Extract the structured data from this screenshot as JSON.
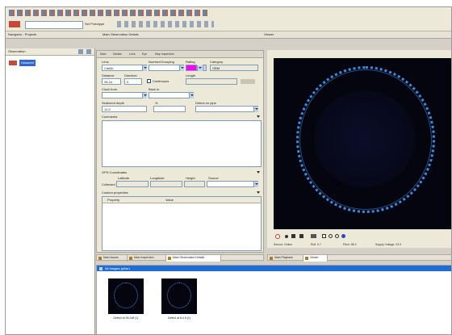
{
  "toolbar": {
    "prototype_label": "Set Prototype"
  },
  "panels": {
    "navigator_tab": "Navigator - Projects",
    "observation_tab": "Main Observation Details",
    "viewer_tab": "Viewer"
  },
  "navigator": {
    "header": "Observation",
    "tree_item": "Unsaved"
  },
  "form": {
    "subtabs": [
      "Main",
      "Details",
      "Lens",
      "Eye",
      "Map Inspection"
    ],
    "labels": {
      "lens": "Lens",
      "number_grouping": "Number/Grouping",
      "rating": "Rating",
      "category": "Category",
      "distance": "Distance",
      "direction": "Direction",
      "length": "Length",
      "continuous": "Continuous",
      "clock_from": "Clock from",
      "clock_to": "Back to",
      "sediment_depth": "Sediment depth",
      "percent": "%",
      "defect_on_pipe": "Defect on pipe",
      "comments": "Comments",
      "gps_coordinates": "GPS Coordinates",
      "latitude": "Latitude",
      "longitude": "Longitude",
      "height": "Height",
      "source": "Source",
      "collected": "Collected",
      "custom_properties": "Custom properties",
      "property_col": "Property",
      "value_col": "Value"
    },
    "values": {
      "lens": "Cal&lt;",
      "category": "OBM",
      "distance": "28.24",
      "direction": "0",
      "sediment_depth": "12.0"
    }
  },
  "viewer": {
    "status": {
      "sensor": "Sensor: Online",
      "roll": "Roll: 0.7",
      "pitch": "Pitch: 98.2",
      "voltage": "Supply Voltage: 23.9"
    }
  },
  "bottom_tabs_left": [
    "Main Issues",
    "Main Inspection",
    "Main Observation Details"
  ],
  "bottom_tabs_right": [
    "Main Playback",
    "Viewer"
  ],
  "gallery": {
    "header": "All Images (pillar)",
    "items": [
      {
        "caption": "Defect at 28.24ft (1)"
      },
      {
        "caption": "Defect at 8.4 ft (1)"
      }
    ]
  },
  "colors": {
    "selection": "#316ac5",
    "gallery_header": "#1e6cd6",
    "rating_highlight": "#ff00ff",
    "ring": "#3b8be0"
  }
}
